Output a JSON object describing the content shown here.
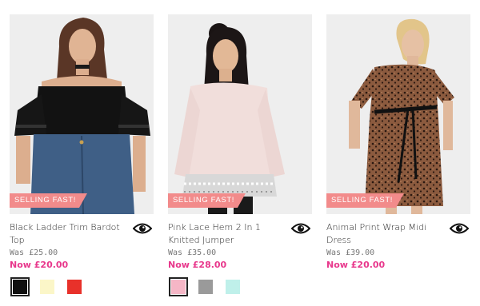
{
  "products": [
    {
      "badge": "SELLING FAST!",
      "name": "Black Ladder Trim Bardot Top",
      "was_label": "Was",
      "was_price": "£25.00",
      "now_price": "Now £20.00",
      "swatches": [
        "#111111",
        "#fbf6c8",
        "#e8312a"
      ],
      "selected_swatch": 0
    },
    {
      "badge": "SELLING FAST!",
      "name": "Pink Lace Hem 2 In 1 Knitted Jumper",
      "was_label": "Was",
      "was_price": "£35.00",
      "now_price": "Now £28.00",
      "swatches": [
        "#f5b6c6",
        "#9a9a9a",
        "#bff0ea"
      ],
      "selected_swatch": 0
    },
    {
      "badge": "SELLING FAST!",
      "name": "Animal Print Wrap Midi Dress",
      "was_label": "Was",
      "was_price": "£39.00",
      "now_price": "Now £20.00",
      "swatches": [],
      "selected_swatch": null
    }
  ],
  "colors": {
    "accent": "#e8388c",
    "badge": "#f28b8b"
  }
}
